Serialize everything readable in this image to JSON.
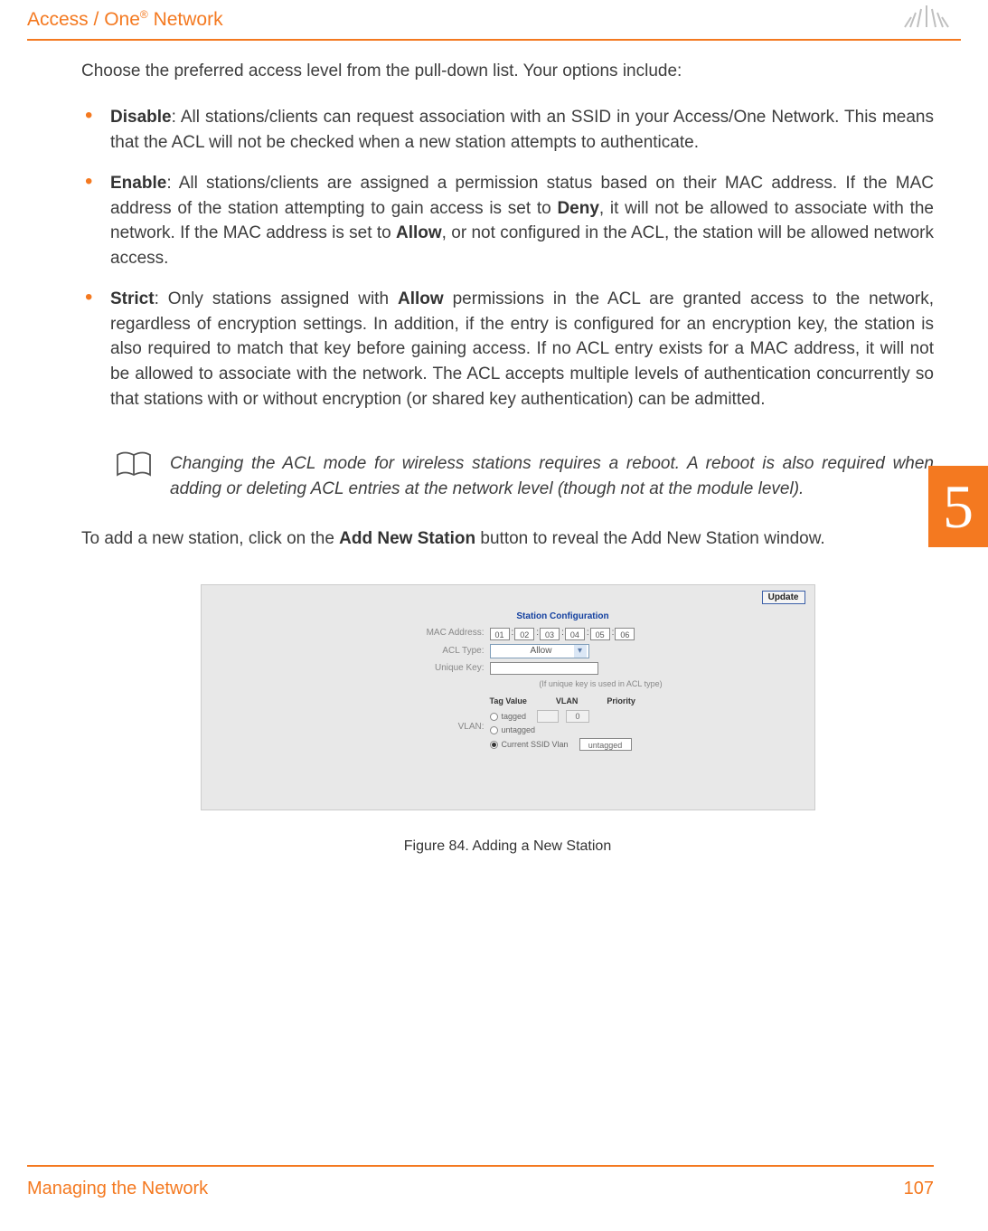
{
  "header": {
    "title_prefix": "Access / One",
    "title_sup": "®",
    "title_suffix": " Network"
  },
  "side_tab": "5",
  "intro": "Choose the preferred access level from the pull-down list. Your options include:",
  "bullets": {
    "disable_label": "Disable",
    "disable_text": ": All stations/clients can request association with an SSID in your Access/One Network. This means that the ACL will not be checked when a new station attempts to authenticate.",
    "enable_label": "Enable",
    "enable_text_a": ": All stations/clients are assigned a permission status based on their MAC address. If the MAC address of the station attempting to gain access is set to ",
    "enable_deny": "Deny",
    "enable_text_b": ", it will not be allowed to associate with the network. If the MAC address is set to ",
    "enable_allow": "Allow",
    "enable_text_c": ", or not configured in the ACL, the station will be allowed network access.",
    "strict_label": "Strict",
    "strict_text_a": ": Only stations assigned with ",
    "strict_allow": "Allow",
    "strict_text_b": " permissions in the ACL are granted access to the network, regardless of encryption settings. In addition, if the entry is configured for an encryption key, the station is also required to match that key before gaining access. If no ACL entry exists for a MAC address, it will not be allowed to associate with the network. The ACL accepts multiple levels of authentication concurrently so that stations with or without encryption (or shared key authentication) can be admitted."
  },
  "note": {
    "text": "Changing the ACL mode for wireless stations requires a reboot. A reboot is also required when adding or deleting ACL entries at the network level (though not at the module level)."
  },
  "add_station": {
    "prefix": "To add a new station, click on the ",
    "bold": "Add New Station",
    "suffix": " button to reveal the Add New Station window."
  },
  "figure": {
    "update": "Update",
    "section": "Station Configuration",
    "mac_label": "MAC Address:",
    "mac": [
      "01",
      "02",
      "03",
      "04",
      "05",
      "06"
    ],
    "acl_label": "ACL Type:",
    "acl_value": "Allow",
    "unique_label": "Unique Key:",
    "unique_note": "(If unique key is used in ACL type)",
    "th1": "Tag Value",
    "th2": "VLAN",
    "th3": "Priority",
    "vlan_label": "VLAN:",
    "opt_tagged": "tagged",
    "opt_untagged": "untagged",
    "opt_current": "Current SSID Vlan",
    "priority_val": "0",
    "current_box": "untagged"
  },
  "caption": "Figure 84. Adding a New Station",
  "footer": {
    "left": "Managing the Network",
    "right": "107"
  }
}
